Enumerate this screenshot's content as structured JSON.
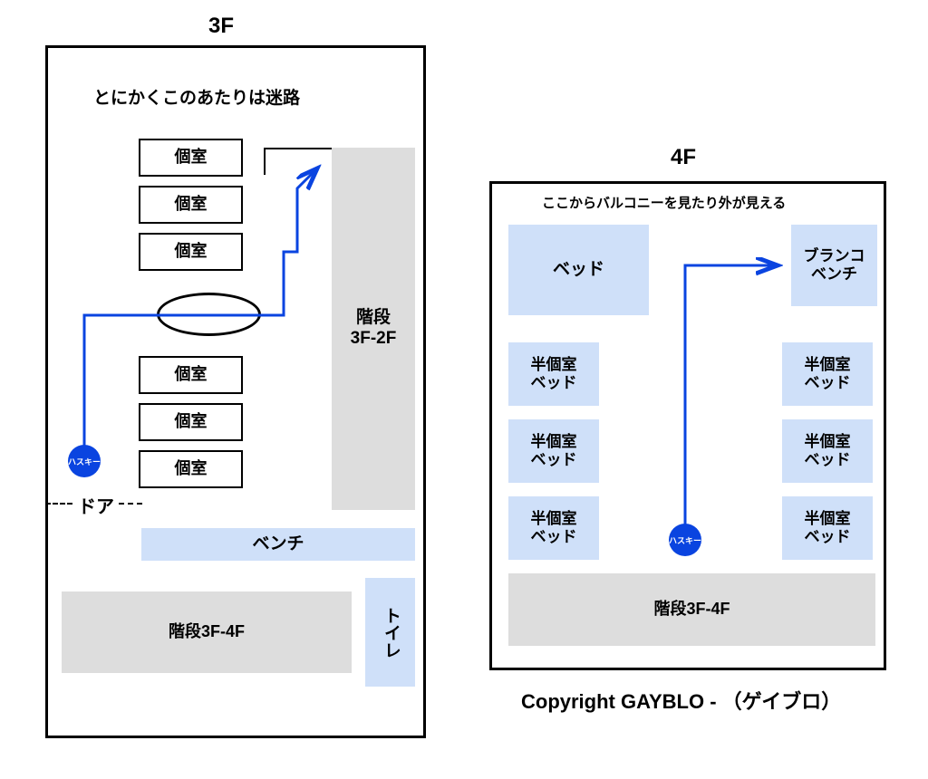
{
  "floor3": {
    "title": "3F",
    "note_maze": "とにかくこのあたりは迷路",
    "rooms_top": [
      "個室",
      "個室",
      "個室"
    ],
    "rooms_bottom": [
      "個室",
      "個室",
      "個室"
    ],
    "stairs_3f2f": "階段\n3F-2F",
    "bench": "ベンチ",
    "stairs_3f4f": "階段3F-4F",
    "toilet": "トイレ",
    "husky": "ハスキー",
    "door": "ドア"
  },
  "floor4": {
    "title": "4F",
    "note_balcony": "ここからバルコニーを見たり外が見える",
    "bed": "ベッド",
    "swing": "ブランコ\nベンチ",
    "half_beds_left": [
      "半個室\nベッド",
      "半個室\nベッド",
      "半個室\nベッド"
    ],
    "half_beds_right": [
      "半個室\nベッド",
      "半個室\nベッド",
      "半個室\nベッド"
    ],
    "stairs": "階段3F-4F",
    "husky": "ハスキー"
  },
  "copyright": "Copyright GAYBLO - （ゲイブロ）"
}
